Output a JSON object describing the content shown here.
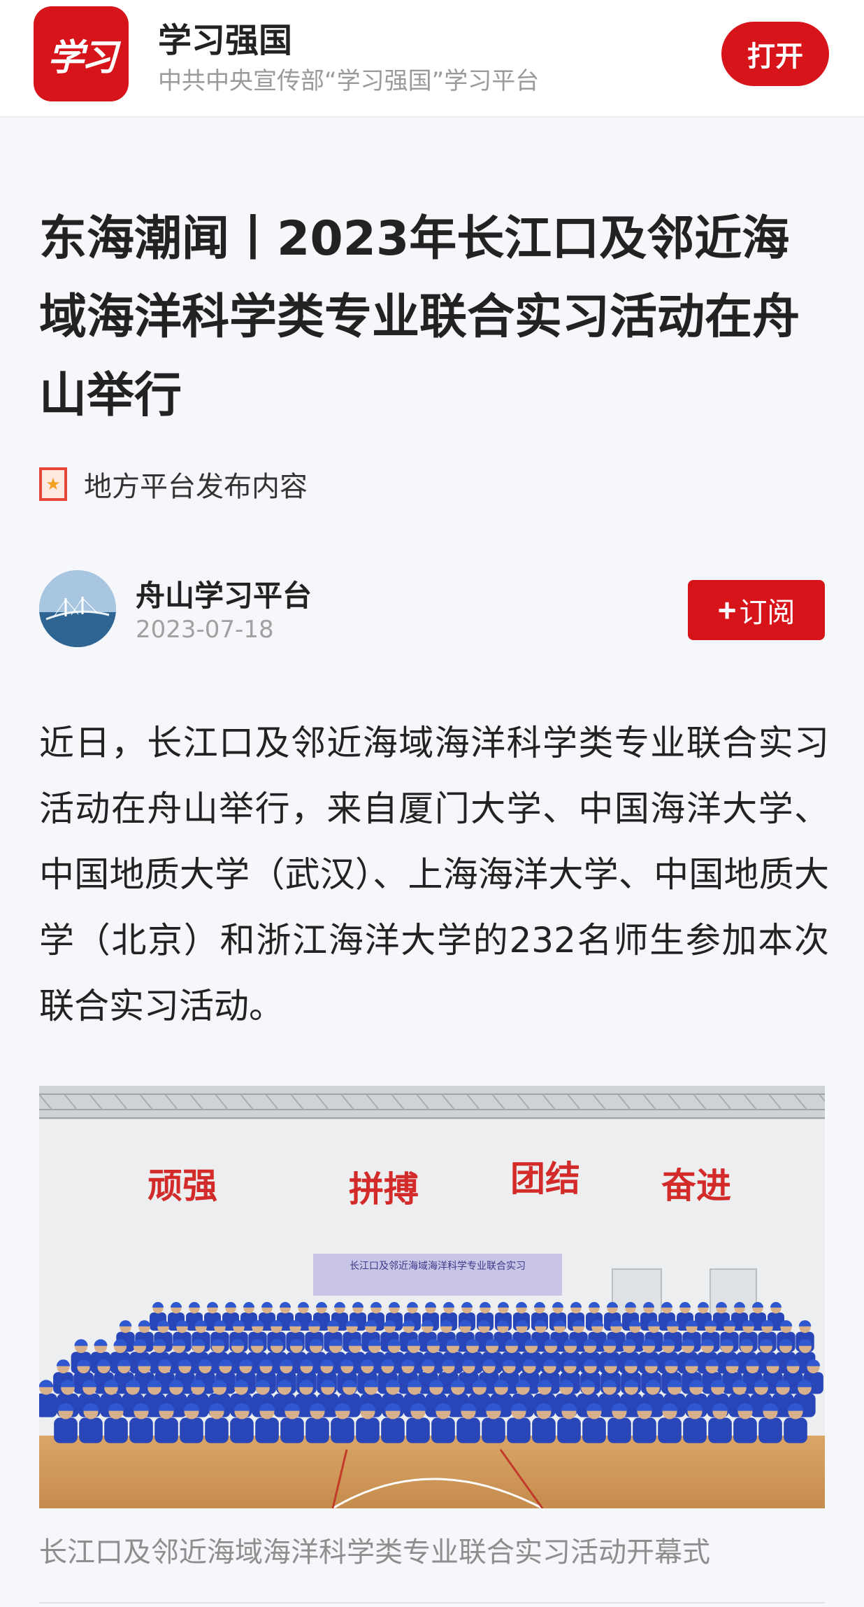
{
  "app_banner": {
    "logo_text": "学习",
    "app_name": "学习强国",
    "app_subtitle": "中共中央宣传部“学习强国”学习平台",
    "open_label": "打开",
    "brand_color": "#d8141b"
  },
  "article": {
    "title": "东海潮闻丨2023年长江口及邻近海域海洋科学类专业联合实习活动在舟山举行",
    "local_tag": {
      "icon": "star-bookmark-icon",
      "label": "地方平台发布内容"
    },
    "author": {
      "name": "舟山学习平台",
      "date": "2023-07-18",
      "avatar": "bridge-over-sea-photo",
      "subscribe_label": "订阅",
      "subscribe_icon": "plus-icon"
    },
    "body": "近日，长江口及邻近海域海洋科学类专业联合实习活动在舟山举行，来自厦门大学、中国海洋大学、中国地质大学（武汉）、上海海洋大学、中国地质大学（北京）和浙江海洋大学的232名师生参加本次联合实习活动。",
    "photo": {
      "wall_slogans": [
        "顽强",
        "拼搏",
        "团结",
        "奋进"
      ],
      "banner_text": "长江口及邻近海域海洋科学专业联合实习"
    },
    "caption": "长江口及邻近海域海洋科学类专业联合实习活动开幕式"
  }
}
